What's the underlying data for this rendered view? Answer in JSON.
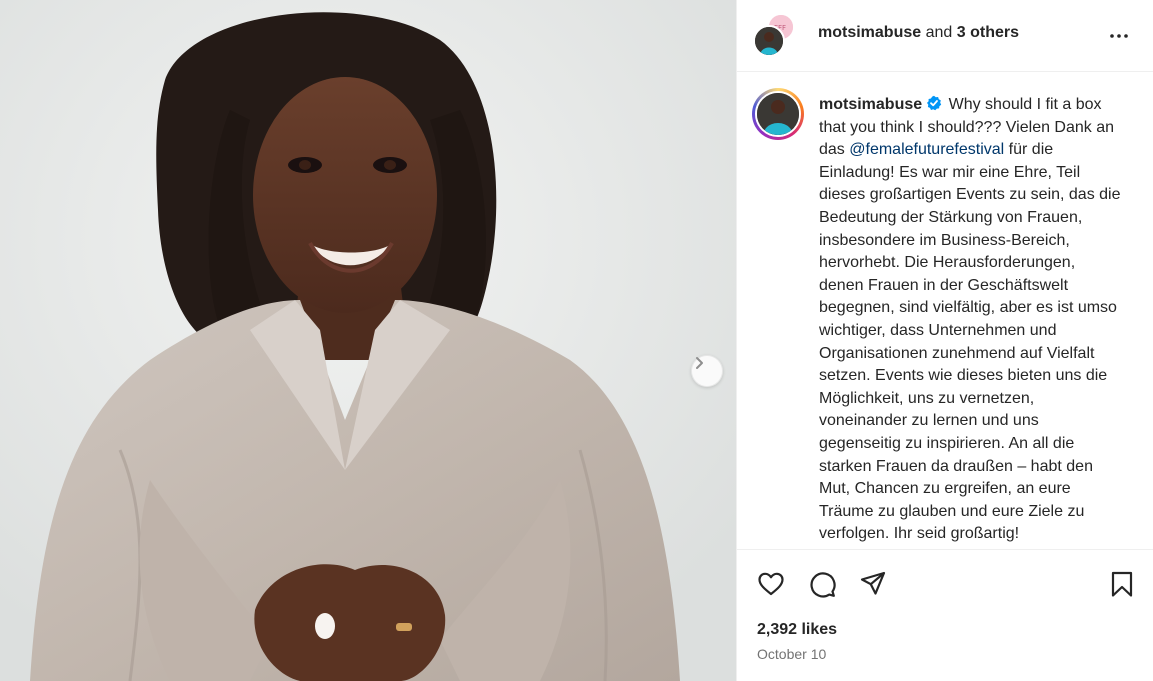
{
  "header": {
    "username": "motsimabuse",
    "and_text": "and",
    "others_text": "3 others"
  },
  "caption": {
    "username": "motsimabuse",
    "text_before_mention": "Why should I fit a box that you think I should??? Vielen Dank an das ",
    "mention": "@femalefuturefestival",
    "text_after_mention": " für die Einladung! Es war mir eine Ehre, Teil dieses großartigen Events zu sein, das die Bedeutung der Stärkung von Frauen, insbesondere im Business-Bereich, hervorhebt. Die Herausforderungen, denen Frauen in der Geschäftswelt begegnen, sind vielfältig, aber es ist umso wichtiger, dass Unternehmen und Organisationen zunehmend auf Vielfalt setzen. Events wie dieses bieten uns die Möglichkeit, uns zu vernetzen, voneinander zu lernen und uns gegenseitig zu inspirieren. An all die starken Frauen da draußen – habt den Mut, Chancen zu ergreifen, an eure Träume zu glauben und eure Ziele zu verfolgen. Ihr seid großartig!"
  },
  "stats": {
    "likes": "2,392 likes",
    "date": "October 10"
  },
  "icons": {
    "more": "more-options-icon",
    "like": "heart-icon",
    "comment": "comment-icon",
    "share": "send-icon",
    "save": "bookmark-icon",
    "next": "chevron-right-icon",
    "verified": "verified-badge-icon"
  },
  "colors": {
    "text": "#262626",
    "secondary": "#737373",
    "link": "#00376b",
    "verified": "#0095f6",
    "border": "#efefef"
  }
}
